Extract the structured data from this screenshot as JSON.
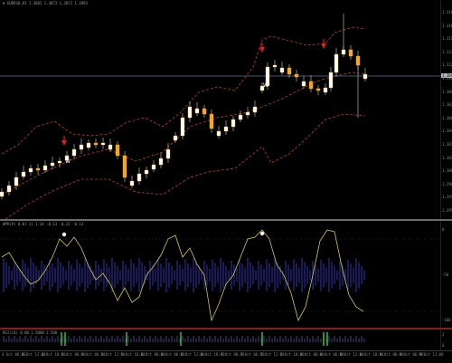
{
  "main_chart": {
    "header": "▼ EURUSD,H1  1.3082 1.3073 1.3072 1.3093",
    "current_price": "1.3093",
    "price_ticks": [
      "1.3180",
      "1.3165",
      "1.3150",
      "1.3135",
      "1.3120",
      "1.3105",
      "1.3090",
      "1.3075",
      "1.3060",
      "1.3045",
      "1.3030",
      "1.3015",
      "1.3000",
      "1.2985",
      "1.2970",
      "1.2955"
    ],
    "markers": [
      {
        "icon": "red-down-arrow-icon",
        "label": "W"
      },
      {
        "icon": "red-down-arrow-icon",
        "label": "W"
      },
      {
        "icon": "red-down-arrow-icon",
        "label": ""
      }
    ],
    "candle_colors": {
      "body": "#f5a623",
      "wick": "#cfcfcf",
      "band": "#c0392b",
      "hline": "#4a7d9a",
      "bear_body": "#ffffff"
    }
  },
  "oscillator": {
    "header": "WPR(9) 0.0(-1) 1.34 -0.13 -0.22 -0.13",
    "ticks": [
      "0",
      "-50",
      "-100"
    ],
    "colors": {
      "line": "#d4c84a",
      "histogram": "#2a2a9a",
      "dot": "#ffffff"
    }
  },
  "lower_indicator": {
    "header": "RSI(14) 0.00 1.5088 2.500",
    "ticks": [
      "2",
      "0"
    ],
    "colors": {
      "signal": "#3ccf3c",
      "bars": "#3a3a6a"
    }
  },
  "time_axis": {
    "labels": [
      "4 Oct 06:00",
      "4 Oct 12:00",
      "4 Oct 18:00",
      "5 Oct 00:00",
      "5 Oct 06:00",
      "5 Oct 12:00",
      "5 Oct 18:00",
      "6 Oct 00:00",
      "6 Oct 06:00",
      "6 Oct 12:00",
      "6 Oct 18:00",
      "7 Oct 00:00",
      "7 Oct 06:00",
      "7 Oct 12:00",
      "7 Oct 18:00",
      "8 Oct 00:00",
      "8 Oct 06:00",
      "8 Oct 12:00",
      "8 Oct 18:00",
      "9 Oct 00:00",
      "9 Oct 06:00",
      "9 Oct 12:00"
    ]
  }
}
